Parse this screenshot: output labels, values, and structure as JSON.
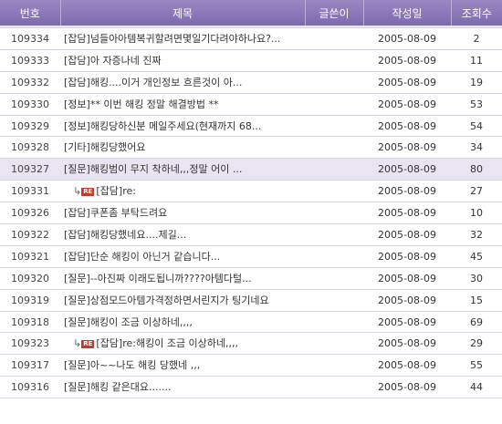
{
  "header": {
    "num": "번호",
    "title": "제목",
    "author": "글쓴이",
    "date": "작성일",
    "views": "조회수"
  },
  "reply_badge": "RE",
  "posts": [
    {
      "num": "109334",
      "title": "[잡담]넘들아아템복귀할려면몇일기다려야하나요?...",
      "date": "2005-08-09",
      "views": "2"
    },
    {
      "num": "109333",
      "title": "[잡담]아 자증나네 진짜",
      "date": "2005-08-09",
      "views": "11"
    },
    {
      "num": "109332",
      "title": "[잡담]해킹....이거 개인정보 흐른것이 아...",
      "date": "2005-08-09",
      "views": "19"
    },
    {
      "num": "109330",
      "title": "[정보]** 이번 해킹 정말 해결방법 **",
      "date": "2005-08-09",
      "views": "53"
    },
    {
      "num": "109329",
      "title": "[정보]해킹당하신분 메일주세요(현재까지 68...",
      "date": "2005-08-09",
      "views": "54"
    },
    {
      "num": "109328",
      "title": "[기타]해킹당했어요",
      "date": "2005-08-09",
      "views": "34"
    },
    {
      "num": "109327",
      "title": "[질문]해킹범이 무지 착하네,,,정말 어이 ...",
      "date": "2005-08-09",
      "views": "80"
    },
    {
      "num": "109331",
      "title": "[잡담]re:",
      "date": "2005-08-09",
      "views": "27"
    },
    {
      "num": "109326",
      "title": "[잡담]쿠폰좀 부탁드려요",
      "date": "2005-08-09",
      "views": "10"
    },
    {
      "num": "109322",
      "title": "[잡담]해킹당했네요....제길...",
      "date": "2005-08-09",
      "views": "32"
    },
    {
      "num": "109321",
      "title": "[잡담]단순 해킹이 아닌거 같습니다...",
      "date": "2005-08-09",
      "views": "45"
    },
    {
      "num": "109320",
      "title": "[질문]--아진짜 이래도됩니까????아템다털...",
      "date": "2005-08-09",
      "views": "30"
    },
    {
      "num": "109319",
      "title": "[질문]상점모드아템가격정하면서린지가 팅기네요",
      "date": "2005-08-09",
      "views": "15"
    },
    {
      "num": "109318",
      "title": "[질문]해킹이 조금 이상하네,,,,",
      "date": "2005-08-09",
      "views": "69"
    },
    {
      "num": "109323",
      "title": "[잡담]re:해킹이 조금 이상하네,,,,",
      "date": "2005-08-09",
      "views": "29"
    },
    {
      "num": "109317",
      "title": "[질문]아~~나도 해킹 당했네 ,,,",
      "date": "2005-08-09",
      "views": "55"
    },
    {
      "num": "109316",
      "title": "[질문]해킹 같은대요.......",
      "date": "2005-08-09",
      "views": "44"
    }
  ]
}
